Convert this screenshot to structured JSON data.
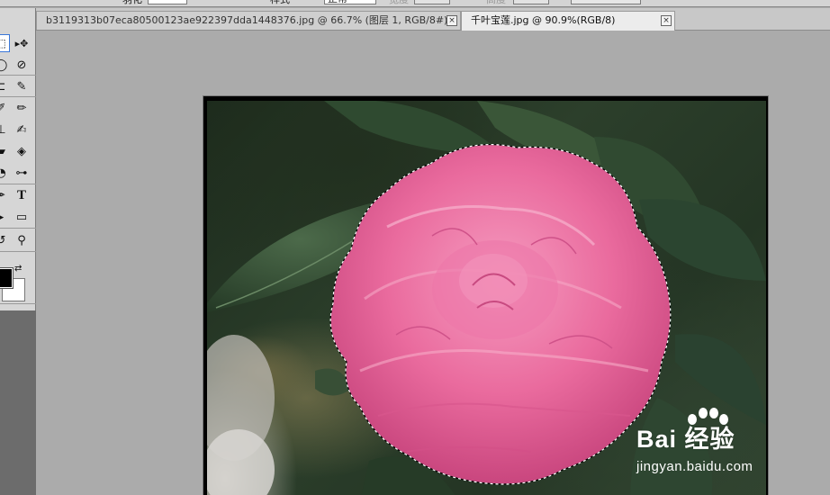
{
  "options_bar": {
    "label_1": "羽化",
    "label_2": "样式",
    "style_value": "正常",
    "label_3": "宽度",
    "label_4": "高度"
  },
  "tabs": [
    {
      "label": "b3119313b07eca80500123ae922397dda1448376.jpg @ 66.7% (图层 1, RGB/8#) *",
      "active": false
    },
    {
      "label": "千叶宝莲.jpg @ 90.9%(RGB/8)",
      "active": true
    }
  ],
  "tab_close_glyph": "×",
  "toolbox": {
    "tools": [
      {
        "name": "marquee-tool",
        "icon": "marquee-icon",
        "glyph": "⬚"
      },
      {
        "name": "move-tool",
        "icon": "move-icon",
        "glyph": "▸✥"
      },
      {
        "name": "lasso-tool",
        "icon": "lasso-icon",
        "glyph": "ᑭ"
      },
      {
        "name": "quick-selection-tool",
        "icon": "quick-selection-icon",
        "glyph": "⊘"
      },
      {
        "name": "crop-tool",
        "icon": "crop-icon",
        "glyph": "⊏"
      },
      {
        "name": "eyedropper-tool",
        "icon": "eyedropper-icon",
        "glyph": "✎"
      },
      {
        "name": "healing-brush-tool",
        "icon": "bandage-icon",
        "glyph": "✐"
      },
      {
        "name": "brush-tool",
        "icon": "brush-icon",
        "glyph": "✏"
      },
      {
        "name": "stamp-tool",
        "icon": "stamp-icon",
        "glyph": "⊥"
      },
      {
        "name": "history-brush-tool",
        "icon": "history-brush-icon",
        "glyph": "✍"
      },
      {
        "name": "eraser-tool",
        "icon": "eraser-icon",
        "glyph": "▰"
      },
      {
        "name": "paint-bucket-tool",
        "icon": "paint-bucket-icon",
        "glyph": "◈"
      },
      {
        "name": "blur-tool",
        "icon": "blur-icon",
        "glyph": "◔"
      },
      {
        "name": "dodge-tool",
        "icon": "dodge-icon",
        "glyph": "⊶"
      },
      {
        "name": "pen-tool",
        "icon": "pen-icon",
        "glyph": "✒"
      },
      {
        "name": "type-tool",
        "icon": "type-icon",
        "glyph": "T"
      },
      {
        "name": "path-selection-tool",
        "icon": "path-selection-icon",
        "glyph": "▸"
      },
      {
        "name": "rectangle-tool",
        "icon": "rectangle-icon",
        "glyph": "▭"
      },
      {
        "name": "rotate-view-tool",
        "icon": "rotate-view-icon",
        "glyph": "↺"
      },
      {
        "name": "zoom-tool",
        "icon": "zoom-icon",
        "glyph": "🔍"
      }
    ],
    "foreground_color": "#000000",
    "background_color": "#ffffff"
  },
  "watermark": {
    "logo_text": "Bai 经验",
    "url": "jingyan.baidu.com"
  },
  "colors": {
    "canvas_bg": "#ababab",
    "selection_marching_ants": "#ffffff",
    "flower_pink": "#e8679a"
  }
}
